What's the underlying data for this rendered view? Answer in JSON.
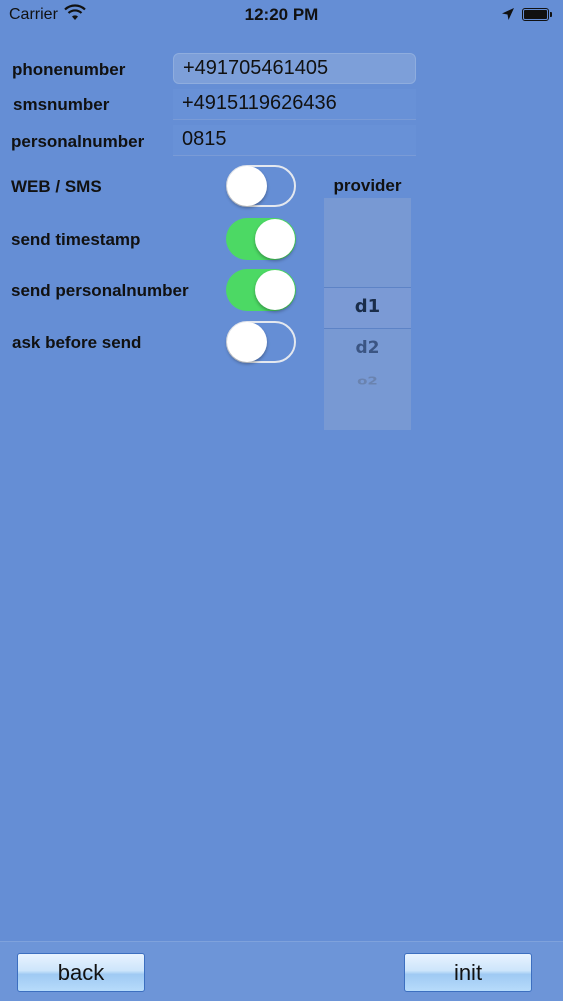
{
  "status_bar": {
    "carrier": "Carrier",
    "time": "12:20 PM",
    "icons": [
      "wifi-icon",
      "location-arrow-icon",
      "battery-icon"
    ]
  },
  "form": {
    "phonenumber": {
      "label": "phonenumber",
      "value": "+491705461405"
    },
    "smsnumber": {
      "label": "smsnumber",
      "value": "+4915119626436"
    },
    "personalnumber": {
      "label": "personalnumber",
      "value": "0815"
    }
  },
  "toggles": {
    "web_sms": {
      "label": "WEB / SMS",
      "on": false
    },
    "send_timestamp": {
      "label": "send timestamp",
      "on": true
    },
    "send_personalnumber": {
      "label": "send personalnumber",
      "on": true
    },
    "ask_before_send": {
      "label": "ask before send",
      "on": false
    }
  },
  "provider": {
    "title": "provider",
    "options": [
      "d1",
      "d2",
      "o2"
    ],
    "selected": "d1"
  },
  "toolbar": {
    "back_label": "back",
    "init_label": "init"
  },
  "colors": {
    "background": "#658ed5",
    "toggle_on": "#4cd964"
  }
}
